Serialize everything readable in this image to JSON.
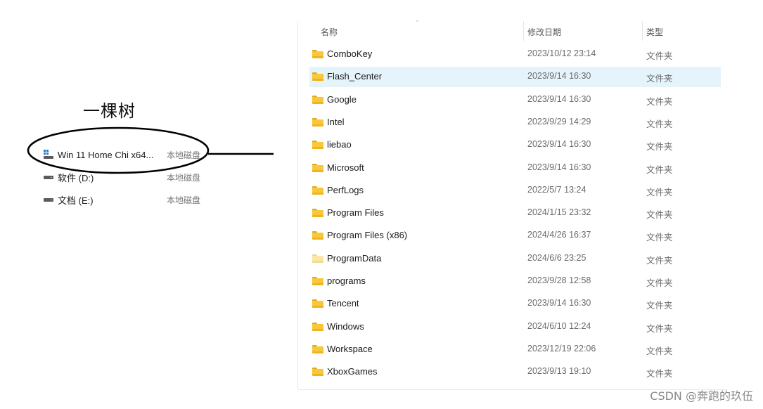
{
  "annotation": {
    "label": "一棵树"
  },
  "drives": [
    {
      "name": "Win 11 Home Chi x64...",
      "type": "本地磁盘",
      "icon": "windows-drive-icon"
    },
    {
      "name": "软件 (D:)",
      "type": "本地磁盘",
      "icon": "hard-drive-icon"
    },
    {
      "name": "文档 (E:)",
      "type": "本地磁盘",
      "icon": "hard-drive-icon"
    }
  ],
  "explorer": {
    "columns": {
      "name": "名称",
      "date": "修改日期",
      "type": "类型"
    },
    "files": [
      {
        "name": "ComboKey",
        "date": "2023/10/12 23:14",
        "type": "文件夹"
      },
      {
        "name": "Flash_Center",
        "date": "2023/9/14 16:30",
        "type": "文件夹",
        "selected": true
      },
      {
        "name": "Google",
        "date": "2023/9/14 16:30",
        "type": "文件夹"
      },
      {
        "name": "Intel",
        "date": "2023/9/29 14:29",
        "type": "文件夹"
      },
      {
        "name": "liebao",
        "date": "2023/9/14 16:30",
        "type": "文件夹"
      },
      {
        "name": "Microsoft",
        "date": "2023/9/14 16:30",
        "type": "文件夹"
      },
      {
        "name": "PerfLogs",
        "date": "2022/5/7 13:24",
        "type": "文件夹"
      },
      {
        "name": "Program Files",
        "date": "2024/1/15 23:32",
        "type": "文件夹"
      },
      {
        "name": "Program Files (x86)",
        "date": "2024/4/26 16:37",
        "type": "文件夹"
      },
      {
        "name": "ProgramData",
        "date": "2024/6/6 23:25",
        "type": "文件夹",
        "faded": true
      },
      {
        "name": "programs",
        "date": "2023/9/28 12:58",
        "type": "文件夹"
      },
      {
        "name": "Tencent",
        "date": "2023/9/14 16:30",
        "type": "文件夹"
      },
      {
        "name": "Windows",
        "date": "2024/6/10 12:24",
        "type": "文件夹"
      },
      {
        "name": "Workspace",
        "date": "2023/12/19 22:06",
        "type": "文件夹"
      },
      {
        "name": "XboxGames",
        "date": "2023/9/13 19:10",
        "type": "文件夹"
      }
    ]
  },
  "watermark": "CSDN @奔跑的玖伍",
  "colors": {
    "selected_row": "#e5f3fb",
    "folder": "#f8c83a"
  }
}
